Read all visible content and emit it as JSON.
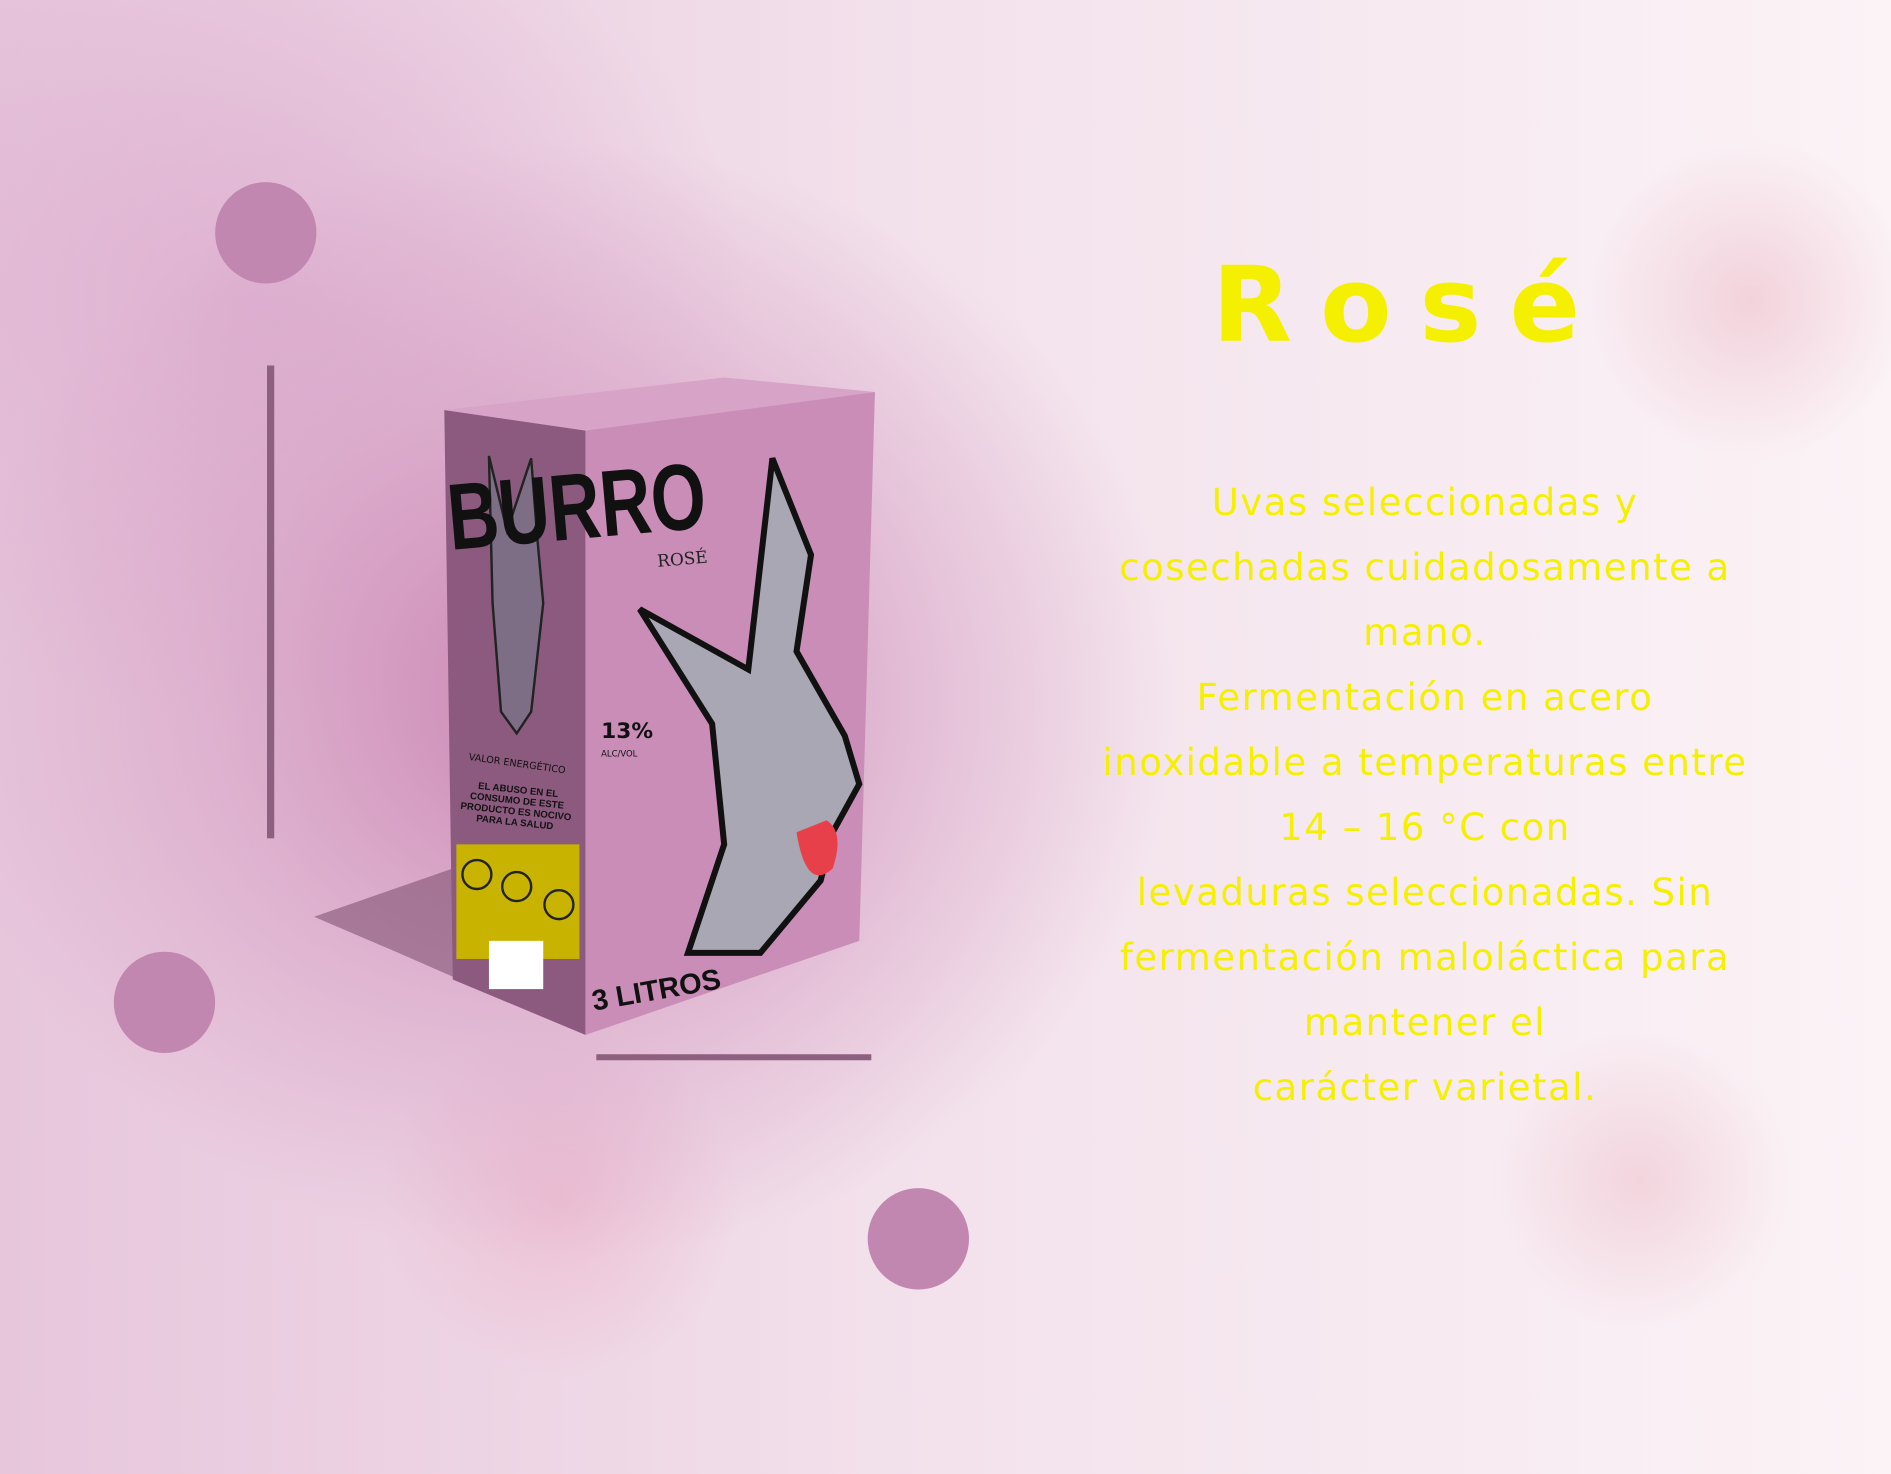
{
  "title": "Rosé",
  "description": "Uvas seleccionadas y\ncosechadas cuidadosamente a\nmano.\nFermentación en acero\ninoxidable a temperaturas entre\n14 – 16 °C con\nlevaduras seleccionadas. Sin\nfermentación maloláctica para\nmantener el\ncarácter varietal.",
  "product": {
    "brand": "BURRO",
    "variety": "ROSÉ",
    "abv": "13%",
    "abv_unit": "ALC/VOL",
    "volume": "3 LITROS",
    "warning": "EL ABUSO EN EL CONSUMO DE ESTE PRODUCTO ES NOCIVO PARA LA SALUD",
    "energy_label": "VALOR ENERGÉTICO"
  },
  "colors": {
    "accent": "#f5f000",
    "circle": "#c287b0",
    "box_front": "#c98db7",
    "box_side": "#8c5a7e",
    "line": "#8e607f"
  }
}
